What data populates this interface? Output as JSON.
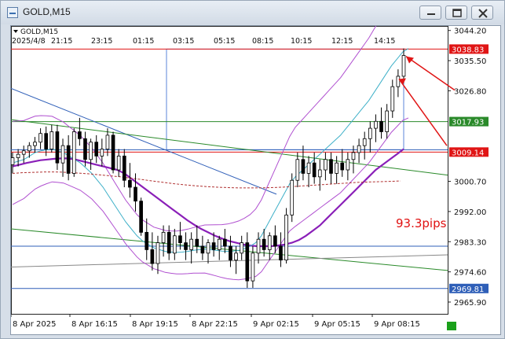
{
  "window": {
    "title": "GOLD,M15"
  },
  "chart_header": {
    "symbol_label": "GOLD,M15",
    "date_label": "2025/4/8",
    "time_labels": [
      "21:15",
      "23:15",
      "01:15",
      "03:15",
      "05:15",
      "08:15",
      "10:15",
      "12:15",
      "14:15"
    ]
  },
  "annotation": {
    "pips_text": "93.3pips",
    "pips_color": "#e01010"
  },
  "price_tags": [
    {
      "label": "3038.83",
      "price": 3038.83,
      "bg": "#e01515"
    },
    {
      "label": "3017.93",
      "price": 3017.93,
      "bg": "#2a8a2a"
    },
    {
      "label": "3009.14",
      "price": 3009.14,
      "bg": "#e01515"
    },
    {
      "label": "2969.81",
      "price": 2969.81,
      "bg": "#2f5fb8"
    }
  ],
  "chart_data": {
    "type": "candlestick",
    "symbol": "GOLD",
    "timeframe": "M15",
    "y_axis": {
      "ticks": [
        "3044.20",
        "3035.50",
        "3026.80",
        "3017.93",
        "3009.14",
        "3000.70",
        "2992.00",
        "2983.30",
        "2974.60",
        "2969.81",
        "2965.90"
      ],
      "ylim": [
        2962.5,
        3045.5
      ]
    },
    "x_axis": {
      "ticks": [
        "8 Apr 2025",
        "8 Apr 16:15",
        "8 Apr 19:15",
        "8 Apr 22:15",
        "9 Apr 02:15",
        "9 Apr 05:15",
        "9 Apr 08:15"
      ]
    },
    "horizontal_lines": [
      {
        "price": 3038.83,
        "color": "#e01515"
      },
      {
        "price": 3017.93,
        "color": "#2a8a2a"
      },
      {
        "price": 3009.14,
        "color": "#e01515"
      },
      {
        "price": 3009.8,
        "color": "#2f5fb8"
      },
      {
        "price": 2982.0,
        "color": "#2f5fb8"
      },
      {
        "price": 2969.81,
        "color": "#2f5fb8"
      }
    ],
    "candles": [
      [
        3005.5,
        3009,
        3003,
        3007.5
      ],
      [
        3007.5,
        3010,
        3005,
        3008.5
      ],
      [
        3008.5,
        3011,
        3006,
        3009.5
      ],
      [
        3009.5,
        3012,
        3007.5,
        3011
      ],
      [
        3011,
        3013.5,
        3009,
        3012
      ],
      [
        3012,
        3016,
        3010,
        3014.5
      ],
      [
        3014.5,
        3016.5,
        3008,
        3010
      ],
      [
        3010,
        3017,
        3009,
        3015
      ],
      [
        3015,
        3017,
        3004,
        3006
      ],
      [
        3006,
        3013,
        3002,
        3011
      ],
      [
        3011,
        3014,
        3001,
        3003
      ],
      [
        3003,
        3016,
        3002,
        3015
      ],
      [
        3015,
        3019,
        3011,
        3013
      ],
      [
        3013,
        3015,
        3005,
        3007
      ],
      [
        3007,
        3013,
        3004,
        3012
      ],
      [
        3012,
        3014,
        3006,
        3008
      ],
      [
        3008,
        3013,
        3005,
        3010
      ],
      [
        3010,
        3016,
        3008,
        3014
      ],
      [
        3014,
        3015,
        3003,
        3004
      ],
      [
        3004,
        3010,
        3002,
        3008
      ],
      [
        3008,
        3010,
        2999,
        3001
      ],
      [
        3001,
        3006,
        2996,
        2999
      ],
      [
        2999,
        3003,
        2992,
        2995
      ],
      [
        2995,
        2996,
        2985,
        2986
      ],
      [
        2986,
        2990,
        2978,
        2981
      ],
      [
        2981,
        2986,
        2975,
        2977
      ],
      [
        2977,
        2985,
        2974,
        2983
      ],
      [
        2983,
        2988,
        2979,
        2986
      ],
      [
        2986,
        2988,
        2978,
        2980
      ],
      [
        2980,
        2987,
        2978,
        2985
      ],
      [
        2985,
        2989,
        2981,
        2983
      ],
      [
        2983,
        2986,
        2978,
        2981
      ],
      [
        2981,
        2986,
        2977,
        2984
      ],
      [
        2984,
        2988,
        2980,
        2982
      ],
      [
        2982,
        2985,
        2978,
        2980
      ],
      [
        2980,
        2984,
        2977,
        2983
      ],
      [
        2983,
        2986,
        2979,
        2981
      ],
      [
        2981,
        2985,
        2978,
        2984
      ],
      [
        2984,
        2987,
        2980,
        2982
      ],
      [
        2982,
        2985,
        2976,
        2978
      ],
      [
        2978,
        2982,
        2974,
        2980
      ],
      [
        2980,
        2985,
        2978,
        2983
      ],
      [
        2983,
        2986,
        2970,
        2972
      ],
      [
        2972,
        2982,
        2970,
        2980
      ],
      [
        2980,
        2986,
        2977,
        2984
      ],
      [
        2984,
        2987,
        2979,
        2981
      ],
      [
        2981,
        2986,
        2978,
        2985
      ],
      [
        2985,
        2988,
        2980,
        2982
      ],
      [
        2982,
        2986,
        2976,
        2978
      ],
      [
        2978,
        2993,
        2977,
        2991
      ],
      [
        2991,
        3003,
        2989,
        3001
      ],
      [
        3001,
        3009,
        2999,
        3007
      ],
      [
        3007,
        3011,
        3001,
        3003
      ],
      [
        3003,
        3008,
        2999,
        3006
      ],
      [
        3006,
        3009,
        3000,
        3002
      ],
      [
        3002,
        3007,
        2998,
        3004
      ],
      [
        3004,
        3009,
        3001,
        3007
      ],
      [
        3007,
        3009,
        3000,
        3003
      ],
      [
        3003,
        3008,
        3000,
        3006
      ],
      [
        3006,
        3010,
        3002,
        3004
      ],
      [
        3004,
        3009,
        3001,
        3007
      ],
      [
        3007,
        3011,
        3003,
        3009
      ],
      [
        3009,
        3013,
        3006,
        3011
      ],
      [
        3011,
        3015,
        3007,
        3013
      ],
      [
        3013,
        3018,
        3009,
        3016
      ],
      [
        3016,
        3020,
        3012,
        3018
      ],
      [
        3018,
        3022,
        3013,
        3015
      ],
      [
        3015,
        3023,
        3013,
        3021
      ],
      [
        3021,
        3030,
        3019,
        3028
      ],
      [
        3028,
        3033,
        3025,
        3031
      ],
      [
        3031,
        3039,
        3029,
        3037
      ]
    ],
    "moving_averages": [
      {
        "name": "",
        "color": "#8a1fb8",
        "width": 2.2,
        "values": [
          3005,
          3005.5,
          3006,
          3006.4,
          3006.8,
          3007,
          3007.2,
          3007.3,
          3007.3,
          3007,
          3006.5,
          3006,
          3005.5,
          3005,
          3004.5,
          3004,
          3003,
          3001.5,
          3000,
          2998.5,
          2997,
          2995.5,
          2994,
          2992.5,
          2991,
          2989.5,
          2988.2,
          2987,
          2986,
          2985,
          2984.2,
          2983.5,
          2983,
          2982.5,
          2982.2,
          2982,
          2982,
          2982,
          2982.2,
          2982.5,
          2983,
          2983.8,
          2985,
          2986.5,
          2988,
          2990,
          2992,
          2994,
          2996,
          2998,
          3000,
          3002,
          3004,
          3005.5,
          3007,
          3008.5,
          3010
        ]
      },
      {
        "name": "",
        "color": "#3eb0c8",
        "width": 1,
        "values": [
          3006,
          3006.5,
          3007,
          3008,
          3009,
          3009.5,
          3009.8,
          3010,
          3009.5,
          3009,
          3008,
          3007,
          3006,
          3004.5,
          3003,
          3001,
          2999,
          2996.5,
          2994,
          2991.5,
          2989,
          2987,
          2985,
          2983.5,
          2982.5,
          2981.5,
          2981,
          2980.5,
          2980.3,
          2980.2,
          2980.3,
          2980.5,
          2980.8,
          2981,
          2981.2,
          2981,
          2980.8,
          2980.6,
          2980.5,
          2980.6,
          2980.8,
          2981.3,
          2982,
          2983,
          2985,
          2988,
          2991,
          2994,
          2997,
          3000,
          3002,
          3003.5,
          3005,
          3006.5,
          3008,
          3009.5,
          3011,
          3012.5,
          3014,
          3016,
          3018,
          3020,
          3022,
          3024,
          3026.5,
          3029,
          3031.5,
          3034,
          3036,
          3038,
          3039
        ]
      },
      {
        "name": "",
        "color": "#b03030",
        "width": 1,
        "dashed": true,
        "values": [
          3003,
          3003.2,
          3003.3,
          3003.4,
          3003.4,
          3003.3,
          3003.1,
          3002.9,
          3002.6,
          3002.3,
          3002,
          3001.6,
          3001.2,
          3000.8,
          3000.4,
          3000,
          2999.7,
          2999.4,
          2999.2,
          2999,
          2998.9,
          2998.8,
          2998.8,
          2998.8,
          2998.9,
          2999,
          2999.2,
          2999.4,
          2999.6,
          2999.8,
          3000,
          3000.2,
          3000.4,
          3000.5,
          3000.6,
          3000.7,
          3000.8
        ]
      }
    ],
    "bands": [
      {
        "name": "",
        "color": "#b050d0",
        "upper": true
      },
      {
        "name": "",
        "color": "#b050d0",
        "upper": false
      }
    ],
    "trendlines": [
      {
        "from": [
          "8 Apr 2025",
          3027.5
        ],
        "to": [
          "9 Apr 02:15",
          2997
        ],
        "color": "#2f5fb8"
      },
      {
        "from": [
          "8 Apr 2025",
          3018.5
        ],
        "to": [
          "9 Apr 08:15",
          3002.5
        ],
        "color": "#2a8a2a"
      },
      {
        "from": [
          "8 Apr 2025",
          2987
        ],
        "to": [
          "9 Apr 08:15",
          2975
        ],
        "color": "#2a8a2a"
      },
      {
        "from": [
          "8 Apr 2025",
          2976
        ],
        "to": [
          "9 Apr 08:15",
          2979.5
        ],
        "color": "#888888"
      }
    ],
    "arrows": [
      {
        "color": "#e01515",
        "target": "last-high"
      },
      {
        "color": "#e01515",
        "target": "lower-band"
      }
    ],
    "annotations": [
      "93.3pips"
    ]
  }
}
